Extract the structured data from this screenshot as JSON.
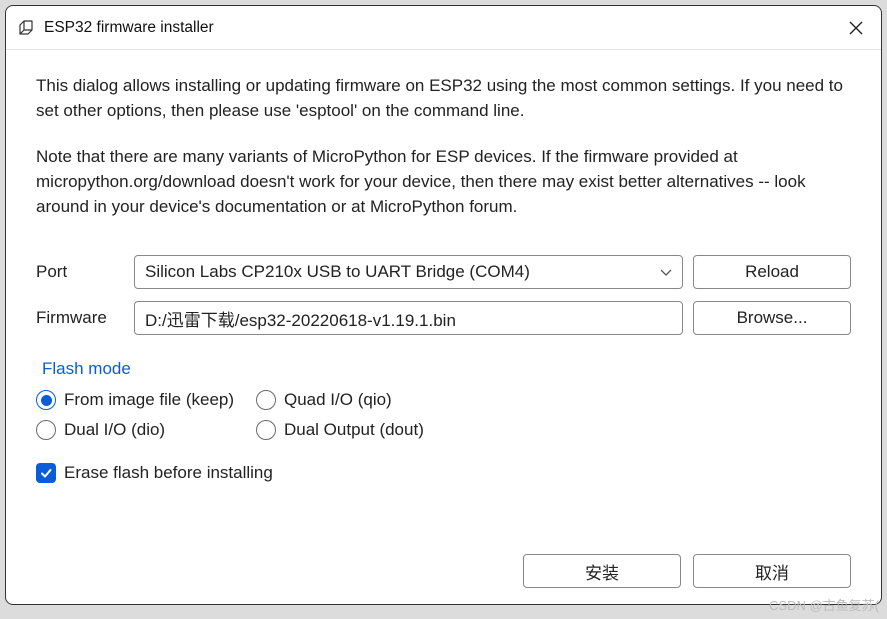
{
  "window": {
    "title": "ESP32 firmware installer"
  },
  "intro": {
    "p1": "This dialog allows installing or updating firmware on ESP32 using the most common settings. If you need to set other options, then please use 'esptool' on the command line.",
    "p2": "Note that there are many variants of MicroPython for ESP devices. If the firmware provided at micropython.org/download doesn't work for your device, then there may exist better alternatives -- look around in your device's documentation or at MicroPython forum."
  },
  "form": {
    "port_label": "Port",
    "port_value": "Silicon Labs CP210x USB to UART Bridge (COM4)",
    "reload_label": "Reload",
    "firmware_label": "Firmware",
    "firmware_value": "D:/迅雷下载/esp32-20220618-v1.19.1.bin",
    "browse_label": "Browse..."
  },
  "flash_mode": {
    "title": "Flash mode",
    "options": [
      {
        "label": "From image file (keep)",
        "checked": true
      },
      {
        "label": "Quad I/O (qio)",
        "checked": false
      },
      {
        "label": "Dual I/O (dio)",
        "checked": false
      },
      {
        "label": "Dual Output (dout)",
        "checked": false
      }
    ]
  },
  "erase": {
    "label": "Erase flash before installing",
    "checked": true
  },
  "footer": {
    "install": "安装",
    "cancel": "取消"
  },
  "watermark": "CSDN @古鱼复苏("
}
